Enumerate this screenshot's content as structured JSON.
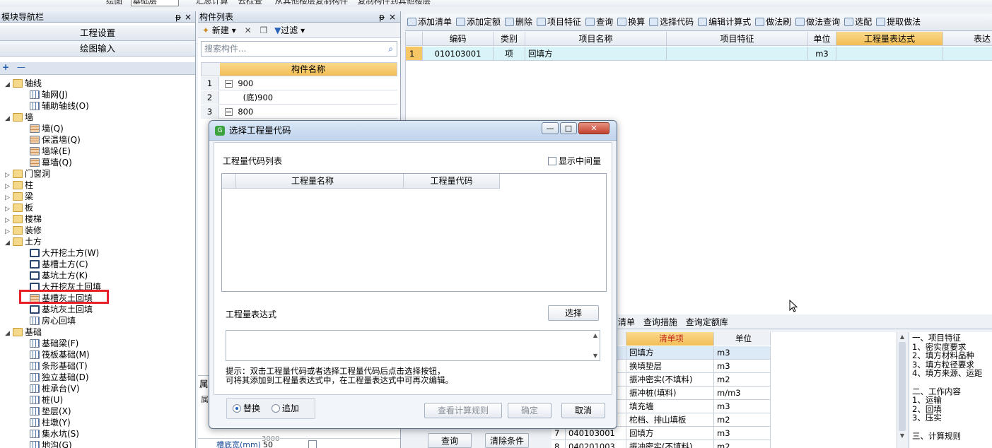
{
  "top_strip": {
    "items": [
      "绘图",
      "基础层",
      "汇总计算",
      "云检查",
      "从其他楼层复制构件",
      "复制构件到其他楼层"
    ]
  },
  "left_panel": {
    "title": "模块导航栏",
    "pin": "ᵽ",
    "close": "×",
    "btn_project_settings": "工程设置",
    "btn_drawing_input": "绘图输入",
    "plus": "+",
    "minus": "—",
    "tree": [
      {
        "toggle": "◢",
        "icon": "folder",
        "label": "轴线",
        "level": 0
      },
      {
        "toggle": "",
        "icon": "grid",
        "label": "轴网(J)",
        "level": 1
      },
      {
        "toggle": "",
        "icon": "grid",
        "label": "辅助轴线(O)",
        "level": 1
      },
      {
        "toggle": "◢",
        "icon": "folder",
        "label": "墙",
        "level": 0
      },
      {
        "toggle": "",
        "icon": "wall",
        "label": "墙(Q)",
        "level": 1
      },
      {
        "toggle": "",
        "icon": "wall",
        "label": "保温墙(Q)",
        "level": 1
      },
      {
        "toggle": "",
        "icon": "wall",
        "label": "墙垛(E)",
        "level": 1
      },
      {
        "toggle": "",
        "icon": "wall",
        "label": "幕墙(Q)",
        "level": 1
      },
      {
        "toggle": "▷",
        "icon": "folder",
        "label": "门窗洞",
        "level": 0
      },
      {
        "toggle": "▷",
        "icon": "folder",
        "label": "柱",
        "level": 0
      },
      {
        "toggle": "▷",
        "icon": "folder",
        "label": "梁",
        "level": 0
      },
      {
        "toggle": "▷",
        "icon": "folder",
        "label": "板",
        "level": 0
      },
      {
        "toggle": "▷",
        "icon": "folder",
        "label": "楼梯",
        "level": 0
      },
      {
        "toggle": "▷",
        "icon": "folder",
        "label": "装修",
        "level": 0
      },
      {
        "toggle": "◢",
        "icon": "folder",
        "label": "土方",
        "level": 0
      },
      {
        "toggle": "",
        "icon": "dig",
        "label": "大开挖土方(W)",
        "level": 1
      },
      {
        "toggle": "",
        "icon": "dig",
        "label": "基槽土方(C)",
        "level": 1
      },
      {
        "toggle": "",
        "icon": "dig",
        "label": "基坑土方(K)",
        "level": 1
      },
      {
        "toggle": "",
        "icon": "dig",
        "label": "大开挖灰土回填",
        "level": 1
      },
      {
        "toggle": "",
        "icon": "wall",
        "label": "基槽灰土回填",
        "level": 1
      },
      {
        "toggle": "",
        "icon": "dig",
        "label": "基坑灰土回填",
        "level": 1
      },
      {
        "toggle": "",
        "icon": "grid",
        "label": "房心回填",
        "level": 1
      },
      {
        "toggle": "◢",
        "icon": "folder",
        "label": "基础",
        "level": 0
      },
      {
        "toggle": "",
        "icon": "grid",
        "label": "基础梁(F)",
        "level": 1
      },
      {
        "toggle": "",
        "icon": "grid",
        "label": "筏板基础(M)",
        "level": 1
      },
      {
        "toggle": "",
        "icon": "grid",
        "label": "条形基础(T)",
        "level": 1
      },
      {
        "toggle": "",
        "icon": "grid",
        "label": "独立基础(D)",
        "level": 1
      },
      {
        "toggle": "",
        "icon": "grid",
        "label": "桩承台(V)",
        "level": 1
      },
      {
        "toggle": "",
        "icon": "grid",
        "label": "桩(U)",
        "level": 1
      },
      {
        "toggle": "",
        "icon": "grid",
        "label": "垫层(X)",
        "level": 1
      },
      {
        "toggle": "",
        "icon": "grid",
        "label": "柱墩(Y)",
        "level": 1
      },
      {
        "toggle": "",
        "icon": "grid",
        "label": "集水坑(S)",
        "level": 1
      },
      {
        "toggle": "",
        "icon": "grid",
        "label": "地沟(G)",
        "level": 1
      }
    ]
  },
  "mid_panel": {
    "title": "构件列表",
    "pin": "ᵽ",
    "close": "×",
    "toolbar": {
      "new": "新建",
      "delete_icon": "✕",
      "filter": "过滤"
    },
    "search_placeholder": "搜索构件...",
    "column_header": "构件名称",
    "rows": [
      {
        "n": "1",
        "toggle": "−",
        "name": "900"
      },
      {
        "n": "2",
        "toggle": "",
        "name": "(底)900"
      },
      {
        "n": "3",
        "toggle": "−",
        "name": "800"
      }
    ],
    "props_title": "属",
    "props_col": "属",
    "prop_rows": [
      {
        "name": "槽底宽(mm)",
        "value": "50"
      }
    ],
    "hidden_row_value": "3000"
  },
  "toolbar": {
    "items": [
      "添加清单",
      "添加定额",
      "删除",
      "项目特征",
      "查询",
      "换算",
      "选择代码",
      "编辑计算式",
      "做法刷",
      "做法查询",
      "选配",
      "提取做法"
    ]
  },
  "top_grid": {
    "headers": [
      "编码",
      "类别",
      "项目名称",
      "项目特征",
      "单位",
      "工程量表达式",
      "表达"
    ],
    "row": {
      "n": "1",
      "code": "010103001",
      "type": "项",
      "name": "回填方",
      "feature": "",
      "unit": "m3",
      "expr": "",
      "expr2": ""
    }
  },
  "dialog": {
    "title": "选择工程量代码",
    "ctrl_min": "—",
    "ctrl_max": "□",
    "ctrl_close": "✕",
    "list_label": "工程量代码列表",
    "show_middle": "显示中间量",
    "col_name": "工程量名称",
    "col_code": "工程量代码",
    "expr_label": "工程量表达式",
    "btn_select": "选择",
    "expr_value": "",
    "hint_line1": "提示：双击工程量代码或者选择工程量代码后点击选择按钮，",
    "hint_line2": "可将其添加到工程量表达式中，在工程量表达式中可再次编辑。",
    "radio_replace": "替换",
    "radio_append": "追加",
    "btn_view_rules": "查看计算规则",
    "btn_ok": "确定",
    "btn_cancel": "取消"
  },
  "bottom": {
    "tabs": [
      "清单",
      "查询措施",
      "查询定额库"
    ],
    "headers": [
      "清单项",
      "单位"
    ],
    "rows": [
      {
        "n": "",
        "code": "",
        "name": "回填方",
        "unit": "m3"
      },
      {
        "n": "",
        "code": "",
        "name": "换填垫层",
        "unit": "m3"
      },
      {
        "n": "",
        "code": "",
        "name": "振冲密实(不填料)",
        "unit": "m2"
      },
      {
        "n": "",
        "code": "",
        "name": "振冲桩(填料)",
        "unit": "m/m3"
      },
      {
        "n": "",
        "code": "",
        "name": "填充墙",
        "unit": "m3"
      },
      {
        "n": "",
        "code": "",
        "name": "柁档、排山填板",
        "unit": "m2"
      },
      {
        "n": "7",
        "code": "040103001",
        "name": "回填方",
        "unit": "m3"
      },
      {
        "n": "8",
        "code": "040201003",
        "name": "振冲密实(不填料)",
        "unit": "m2"
      }
    ],
    "btn_query": "查询",
    "btn_clear": "清除条件",
    "notes": [
      "一、项目特征",
      "1、密实度要求",
      "2、填方材料品种",
      "3、填方粒径要求",
      "4、填方来源、运距",
      "",
      "二、工作内容",
      "1、运输",
      "2、回填",
      "3、压实",
      "",
      "三、计算规则"
    ]
  },
  "colors": {
    "selected_header": "#f7c766",
    "highlight_row": "#d8f4f8",
    "marker": "#e8202a"
  }
}
